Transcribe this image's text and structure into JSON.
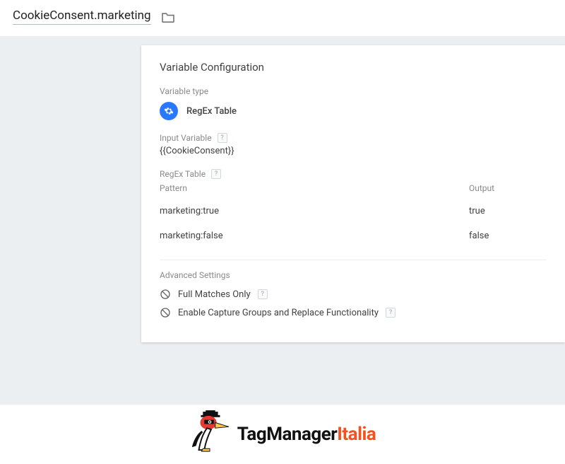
{
  "header": {
    "title": "CookieConsent.marketing"
  },
  "card": {
    "title": "Variable Configuration",
    "var_type_label": "Variable type",
    "var_type_name": "RegEx Table",
    "input_variable_label": "Input Variable",
    "input_variable_value": "{{CookieConsent}}",
    "regex_table_label": "RegEx Table",
    "pattern_header": "Pattern",
    "output_header": "Output",
    "rows": [
      {
        "pattern": "marketing:true",
        "output": "true"
      },
      {
        "pattern": "marketing:false",
        "output": "false"
      }
    ],
    "advanced_label": "Advanced Settings",
    "adv1": "Full Matches Only",
    "adv2": "Enable Capture Groups and Replace Functionality",
    "help_glyph": "?"
  },
  "logo": {
    "part1": "TagManager",
    "part2": "Italia"
  }
}
